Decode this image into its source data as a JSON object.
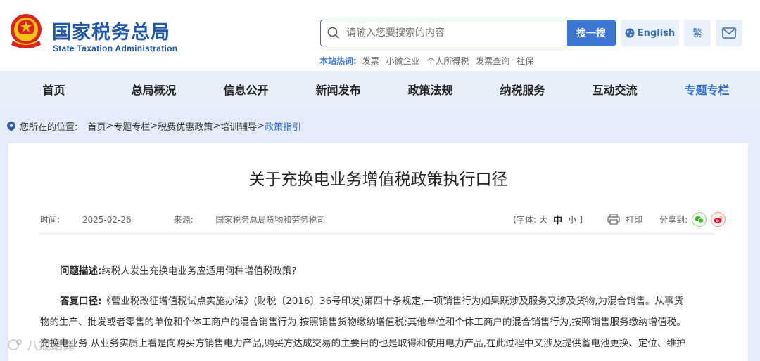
{
  "header": {
    "site_name_cn": "国家税务总局",
    "site_name_en": "State Taxation Administration",
    "search": {
      "placeholder": "请输入您要搜索的内容",
      "button": "搜一搜"
    },
    "hot_label": "本站热词:",
    "hot_words": [
      "发票",
      "小微企业",
      "个人所得税",
      "发票查询",
      "社保"
    ],
    "english_label": "English",
    "traditional_label": "繁"
  },
  "nav": {
    "items": [
      {
        "label": "首页"
      },
      {
        "label": "总局概况"
      },
      {
        "label": "信息公开"
      },
      {
        "label": "新闻发布"
      },
      {
        "label": "政策法规"
      },
      {
        "label": "纳税服务"
      },
      {
        "label": "互动交流"
      },
      {
        "label": "专题专栏"
      }
    ],
    "active_index": 7
  },
  "breadcrumb": {
    "prefix": "您所在的位置:",
    "items": [
      "首页",
      "专题专栏",
      "税费优惠政策",
      "培训辅导"
    ],
    "separator": ">",
    "current": "政策指引"
  },
  "article": {
    "title": "关于充换电业务增值税政策执行口径",
    "time_label": "时间:",
    "time": "2025-02-26",
    "source_label": "来源:",
    "source": "国家税务总局货物和劳务税司",
    "font_label": "【字体:",
    "font_large": "大",
    "font_mid": "中",
    "font_small": "小",
    "font_end": "】",
    "print_label": "打印",
    "share_label": "分享到:",
    "question_label": "问题描述:",
    "question": "纳税人发生充换电业务应适用何种增值税政策?",
    "answer_label": "答复口径:",
    "answer_line1": "《营业税改征增值税试点实施办法》(财税〔2016〕36号印发)第四十条规定,一项销售行为如果既涉及服务又涉及货物,为混合销售。从事货",
    "answer_line2": "物的生产、批发或者零售的单位和个体工商户的混合销售行为,按照销售货物缴纳增值税;其他单位和个体工商户的混合销售行为,按照销售服务缴纳增值税。",
    "answer_line3": "充换电业务,从业务实质上看是向购买方销售电力产品,购买方达成交易的主要目的也是取得和使用电力产品,在此过程中又涉及提供蓄电池更换、定位、维护"
  },
  "watermark": "八戒结算",
  "colors": {
    "brand_blue": "#1f58a6",
    "accent_blue": "#3b76d0",
    "nav_bg": "#e6effa"
  }
}
